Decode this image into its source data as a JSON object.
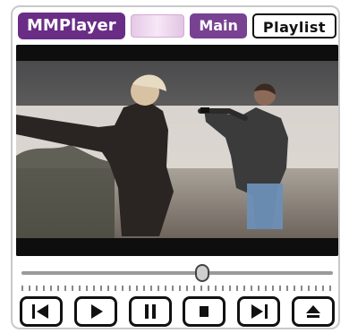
{
  "app": {
    "title": "MMPlayer"
  },
  "tabs": {
    "main": "Main",
    "playlist": "Playlist"
  },
  "playback": {
    "position_fraction": 0.58
  },
  "controls": {
    "buttons": [
      {
        "id": "prev",
        "icon": "skip-previous-icon"
      },
      {
        "id": "play",
        "icon": "play-icon"
      },
      {
        "id": "pause",
        "icon": "pause-icon"
      },
      {
        "id": "stop",
        "icon": "stop-icon"
      },
      {
        "id": "next",
        "icon": "skip-next-icon"
      },
      {
        "id": "eject",
        "icon": "eject-icon"
      }
    ]
  },
  "colors": {
    "accent_purple": "#6a2d86",
    "playlist_tab_border": "#111111"
  }
}
